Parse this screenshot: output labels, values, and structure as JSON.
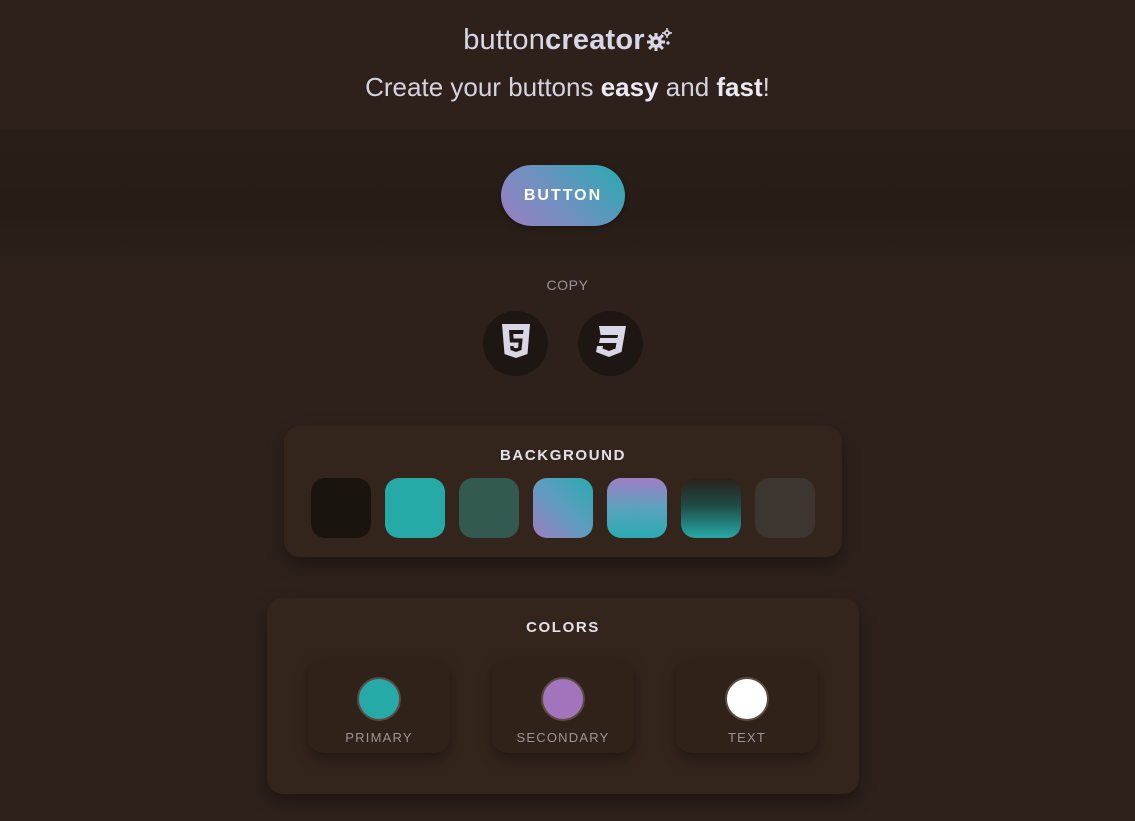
{
  "logo": {
    "part1": "button",
    "part2": "creator",
    "icon": "gears-icon"
  },
  "tagline": {
    "pre": "Create your buttons ",
    "w1": "easy",
    "mid": " and ",
    "w2": "fast",
    "post": "!"
  },
  "preview": {
    "button_label": "BUTTON"
  },
  "copy": {
    "label": "COPY",
    "buttons": [
      {
        "name": "html5",
        "icon": "html5-icon"
      },
      {
        "name": "css3",
        "icon": "css3-icon"
      }
    ]
  },
  "background": {
    "title": "BACKGROUND",
    "swatches": [
      {
        "name": "black",
        "color": "#1a140f"
      },
      {
        "name": "teal",
        "color": "#26aaa8"
      },
      {
        "name": "dark-teal",
        "color": "#325a50"
      },
      {
        "name": "blue-purple-gradient",
        "color": "linear-gradient(45deg,#9c7ec0,#5f9dc0,#29aab0)"
      },
      {
        "name": "purple-teal-gradient",
        "color": "linear-gradient(180deg,#a17ec4,#5aa2bd,#2aabb1)"
      },
      {
        "name": "fade-teal-gradient",
        "color": "linear-gradient(180deg,#2c201a 0%,#1f4a45 45%,#26aaa8 100%)"
      },
      {
        "name": "charcoal",
        "color": "#3c3530"
      }
    ]
  },
  "colors": {
    "title": "COLORS",
    "items": [
      {
        "label": "PRIMARY",
        "value": "#26aaa8"
      },
      {
        "label": "SECONDARY",
        "value": "#a274bc"
      },
      {
        "label": "TEXT",
        "value": "#ffffff"
      }
    ]
  }
}
